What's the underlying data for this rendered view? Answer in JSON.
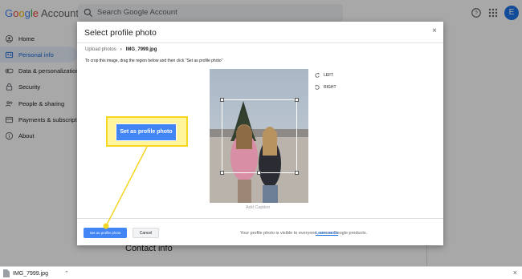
{
  "header": {
    "logo_word": "Google",
    "logo_sub": "Account",
    "search_placeholder": "Search Google Account",
    "avatar_initial": "E"
  },
  "sidebar": {
    "items": [
      {
        "label": "Home",
        "icon": "home-icon",
        "active": false
      },
      {
        "label": "Personal info",
        "icon": "id-card-icon",
        "active": true
      },
      {
        "label": "Data & personalization",
        "icon": "toggle-icon",
        "active": false
      },
      {
        "label": "Security",
        "icon": "lock-icon",
        "active": false
      },
      {
        "label": "People & sharing",
        "icon": "people-icon",
        "active": false
      },
      {
        "label": "Payments & subscriptions",
        "icon": "card-icon",
        "active": false
      },
      {
        "label": "About",
        "icon": "info-icon",
        "active": false
      }
    ]
  },
  "content": {
    "section_title": "Contact info"
  },
  "dialog": {
    "title": "Select profile photo",
    "close": "×",
    "breadcrumb": {
      "root": "Upload photos",
      "separator": "›",
      "file": "IMG_7999.jpg"
    },
    "instruction": "To crop this image, drag the region below and then click \"Set as profile photo\"",
    "rotate_left": "LEFT",
    "rotate_right": "RIGHT",
    "caption": "Add Caption",
    "primary_button": "Set as profile photo",
    "cancel_button": "Cancel",
    "footnote": "Your profile photo is visible to everyone, across Google products.",
    "learn_more": "Learn more"
  },
  "callout": {
    "label": "Set as profile photo",
    "color": "#f5d623"
  },
  "download_bar": {
    "file": "IMG_7999.jpg",
    "show_all": "×"
  },
  "colors": {
    "accent": "#4285f4",
    "active_nav_bg": "#e8f0fe",
    "callout_yellow": "#fff59d"
  }
}
